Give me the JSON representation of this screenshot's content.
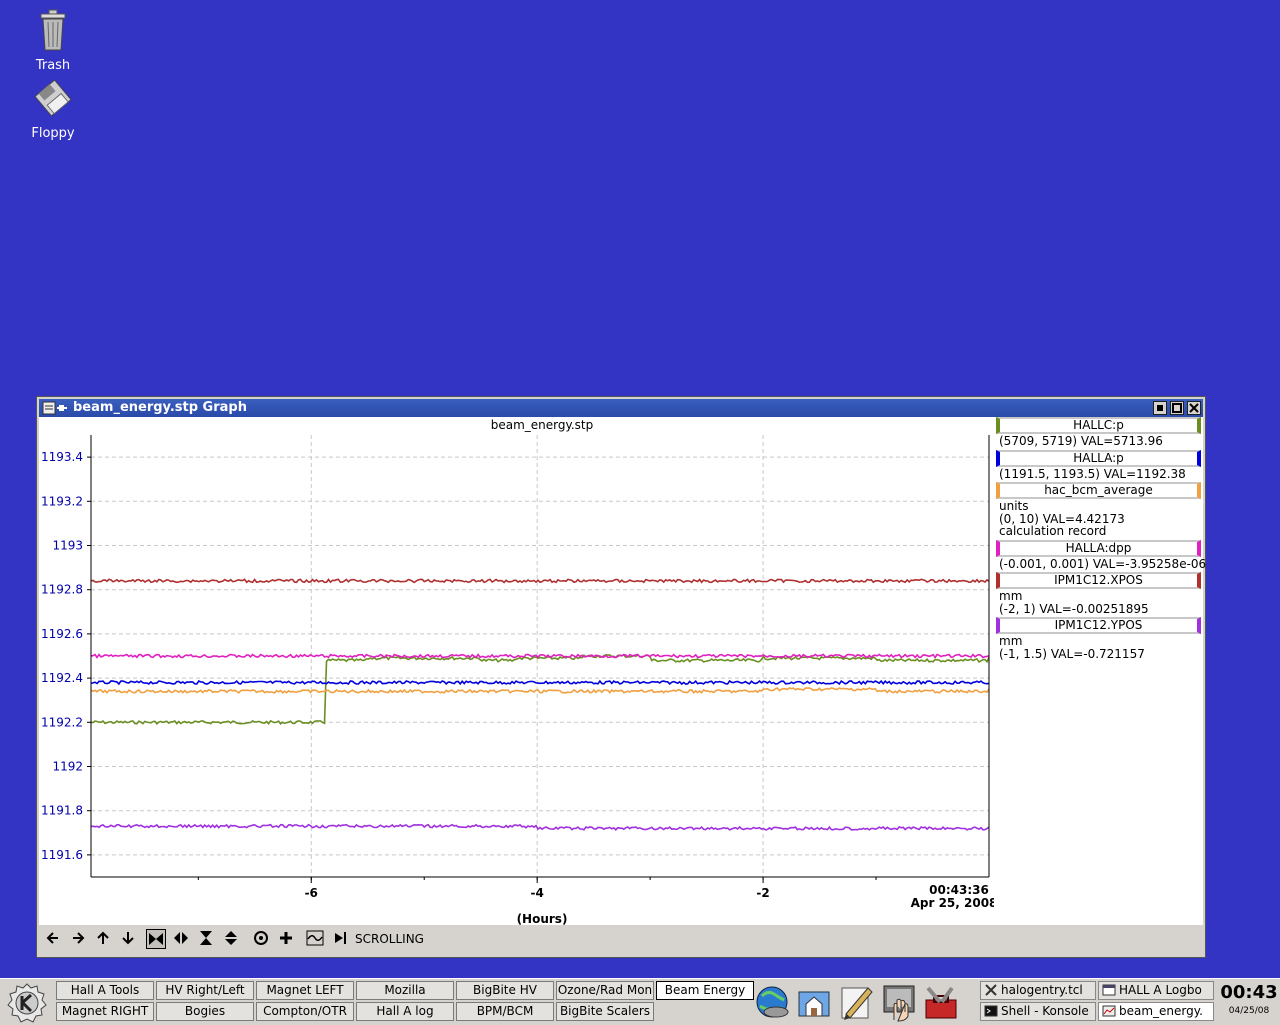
{
  "desktop": {
    "icons": [
      {
        "label": "Trash",
        "icon": "trash-icon"
      },
      {
        "label": "Floppy",
        "icon": "floppy-icon"
      }
    ]
  },
  "window": {
    "title": "beam_energy.stp Graph",
    "plot_title": "beam_energy.stp",
    "x_label": "(Hours)",
    "time_label": "00:43:36",
    "date_label": "Apr 25, 2008",
    "status": "SCROLLING"
  },
  "legend": [
    {
      "name": "HALLC:p",
      "color": "#6b8e23",
      "lines": [
        "(5709, 5719) VAL=5713.96"
      ]
    },
    {
      "name": "HALLA:p",
      "color": "#0000dd",
      "lines": [
        "(1191.5, 1193.5) VAL=1192.38"
      ]
    },
    {
      "name": "hac_bcm_average",
      "color": "#f0a040",
      "lines": [
        "units",
        "(0, 10) VAL=4.42173",
        "calculation record"
      ]
    },
    {
      "name": "HALLA:dpp",
      "color": "#e020c0",
      "lines": [
        "(-0.001, 0.001) VAL=-3.95258e-06"
      ]
    },
    {
      "name": "IPM1C12.XPOS",
      "color": "#b03030",
      "lines": [
        "mm",
        "(-2, 1) VAL=-0.00251895"
      ]
    },
    {
      "name": "IPM1C12.YPOS",
      "color": "#a030e0",
      "lines": [
        "mm",
        "(-1, 1.5) VAL=-0.721157"
      ]
    }
  ],
  "chart_data": {
    "type": "line",
    "title": "beam_energy.stp",
    "xlabel": "(Hours)",
    "ylabel": "",
    "x_ticks": [
      -6,
      -4,
      -2
    ],
    "y_ticks": [
      1193.4,
      1193.2,
      1193,
      1192.8,
      1192.6,
      1192.4,
      1192.2,
      1192,
      1191.8,
      1191.6
    ],
    "xlim": [
      -7.95,
      0
    ],
    "ylim": [
      1191.5,
      1193.5
    ],
    "grid": true,
    "series": [
      {
        "name": "HALLC:p",
        "color": "#6b8e23",
        "x": [
          -7.95,
          -5.9,
          -5.88,
          -5.5,
          -4.5,
          -4.2,
          -3.6,
          -3.0,
          -2.0,
          -1.0,
          0
        ],
        "values": [
          1192.2,
          1192.2,
          1192.48,
          1192.49,
          1192.48,
          1192.49,
          1192.5,
          1192.48,
          1192.49,
          1192.48,
          1192.49
        ]
      },
      {
        "name": "HALLA:p",
        "color": "#0000dd",
        "x": [
          -7.95,
          -6,
          -4,
          -2,
          0
        ],
        "values": [
          1192.38,
          1192.38,
          1192.38,
          1192.38,
          1192.38
        ]
      },
      {
        "name": "hac_bcm_average",
        "color": "#f0a040",
        "x": [
          -7.95,
          -5.9,
          -5.8,
          -4.5,
          -3.0,
          -2.0,
          -1.0,
          0
        ],
        "values": [
          1192.34,
          1192.34,
          1192.34,
          1192.34,
          1192.34,
          1192.35,
          1192.34,
          1192.35
        ]
      },
      {
        "name": "HALLA:dpp",
        "color": "#e020c0",
        "x": [
          -7.95,
          -6,
          -4,
          -2,
          0
        ],
        "values": [
          1192.5,
          1192.5,
          1192.5,
          1192.5,
          1192.5
        ]
      },
      {
        "name": "IPM1C12.XPOS",
        "color": "#b03030",
        "x": [
          -7.95,
          -6,
          -4,
          -2,
          0
        ],
        "values": [
          1192.84,
          1192.84,
          1192.84,
          1192.84,
          1192.84
        ]
      },
      {
        "name": "IPM1C12.YPOS",
        "color": "#a030e0",
        "x": [
          -7.95,
          -6,
          -4,
          -2,
          0
        ],
        "values": [
          1191.73,
          1191.73,
          1191.72,
          1191.72,
          1191.73
        ]
      }
    ],
    "legend_position": "right"
  },
  "taskbar": {
    "row1": [
      "Hall A Tools",
      "HV Right/Left",
      "Magnet LEFT",
      "Mozilla",
      "BigBite HV",
      "Ozone/Rad Mon",
      "Beam Energy"
    ],
    "row2": [
      "Magnet RIGHT",
      "Bogies",
      "Compton/OTR",
      "Hall A log",
      "BPM/BCM",
      "BigBite Scalers"
    ],
    "tasks": [
      {
        "label": "halogentry.tcl",
        "icon": "x-icon"
      },
      {
        "label": "HALL A Logbo",
        "icon": "window-icon"
      },
      {
        "label": "Shell - Konsole",
        "icon": "terminal-icon"
      },
      {
        "label": "beam_energy.",
        "icon": "graph-icon"
      }
    ],
    "clock_time": "00:43",
    "clock_date": "04/25/08"
  }
}
